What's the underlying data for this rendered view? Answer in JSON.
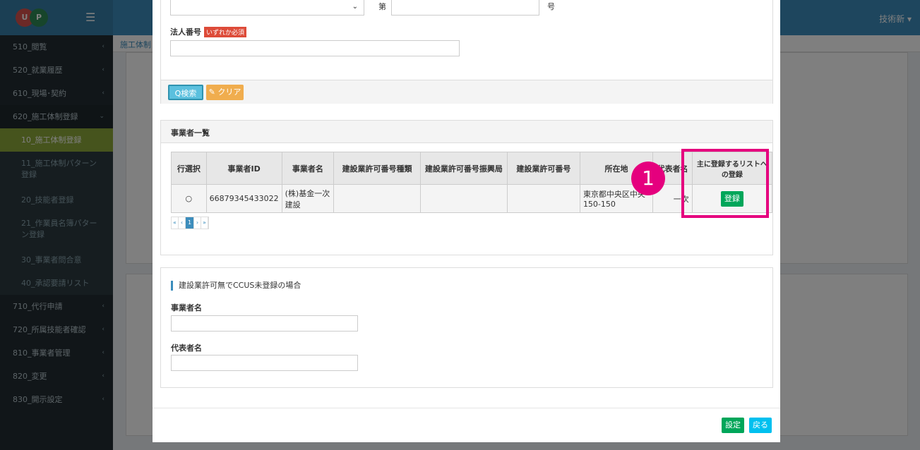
{
  "header": {
    "logo_text_1": "U",
    "logo_text_2": "P",
    "menu_icon": "hamburger-icon",
    "user_name": "技術新 ▾"
  },
  "sidebar": {
    "items": [
      {
        "label": "510_閲覧"
      },
      {
        "label": "520_就業履歴"
      },
      {
        "label": "610_現場･契約"
      },
      {
        "label": "620_施工体制登録"
      }
    ],
    "sub_items": [
      {
        "label": "10_施工体制登録"
      },
      {
        "label": "11_施工体制パターン登録"
      },
      {
        "label": "20_技能者登録"
      },
      {
        "label": "21_作業員名簿パターン登録"
      },
      {
        "label": "30_事業者問合意"
      },
      {
        "label": "40_承認要請リスト"
      }
    ],
    "items_after": [
      {
        "label": "710_代行申請"
      },
      {
        "label": "720_所属技能者確認"
      },
      {
        "label": "810_事業者管理"
      },
      {
        "label": "820_変更"
      },
      {
        "label": "830_開示設定"
      }
    ],
    "chevron": "‹"
  },
  "background": {
    "breadcrumb": "施工体制"
  },
  "modal": {
    "top": {
      "dai_label": "第",
      "go_label": "号"
    },
    "corp_number": {
      "label": "法人番号",
      "required_badge": "いずれか必須"
    },
    "buttons": {
      "search": "Q検索",
      "clear": "クリア"
    },
    "list": {
      "title": "事業者一覧",
      "columns": [
        "行選択",
        "事業者ID",
        "事業者名",
        "建設業許可番号種類",
        "建設業許可番号振興局",
        "建設業許可番号",
        "所在地",
        "代表者名",
        "主に登録するリストへの登録"
      ],
      "rows": [
        {
          "select": "○",
          "id": "66879345433022",
          "name": "(株)基金一次建設",
          "kind": "",
          "bureau": "",
          "number": "",
          "address": "東京都中央区中央150-150",
          "rep": "一次",
          "register": "登録"
        }
      ],
      "pager": [
        "«",
        "‹",
        "1",
        "›",
        "»"
      ]
    },
    "unregistered": {
      "title": "建設業許可無でCCUS未登録の場合",
      "company_label": "事業者名",
      "rep_label": "代表者名"
    },
    "footer": {
      "set": "設定",
      "back": "戻る"
    }
  },
  "annotation": {
    "marker": "1"
  }
}
